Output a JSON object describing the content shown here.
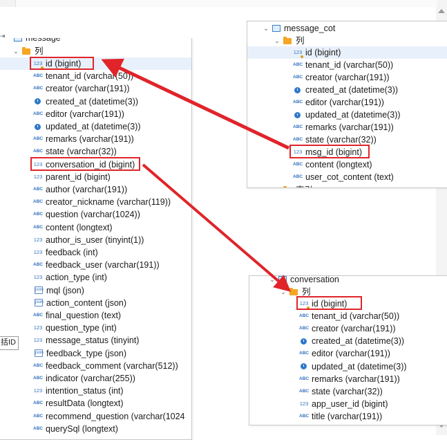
{
  "colors": {
    "highlight": "#e0242a",
    "arrow": "#e0242a",
    "selected_row": "#e8f1fb",
    "type_icon": "#3070c0",
    "folder": "#f5a623"
  },
  "side_label": "括ID",
  "message": {
    "table_name": "message",
    "columns_label": "列",
    "columns": [
      {
        "icon": "key-icon",
        "text": "id (bigint)"
      },
      {
        "icon": "abc-icon",
        "text": "tenant_id (varchar(50))"
      },
      {
        "icon": "abc-icon",
        "text": "creator (varchar(191))"
      },
      {
        "icon": "clock-icon",
        "text": "created_at (datetime(3))"
      },
      {
        "icon": "abc-icon",
        "text": "editor (varchar(191))"
      },
      {
        "icon": "clock-icon",
        "text": "updated_at (datetime(3))"
      },
      {
        "icon": "abc-icon",
        "text": "remarks (varchar(191))"
      },
      {
        "icon": "abc-icon",
        "text": "state (varchar(32))"
      },
      {
        "icon": "num-icon",
        "text": "conversation_id (bigint)"
      },
      {
        "icon": "num-icon",
        "text": "parent_id (bigint)"
      },
      {
        "icon": "abc-icon",
        "text": "author (varchar(191))"
      },
      {
        "icon": "abc-icon",
        "text": "creator_nickname (varchar(119))"
      },
      {
        "icon": "abc-icon",
        "text": "question (varchar(1024))"
      },
      {
        "icon": "abc-icon",
        "text": "content (longtext)"
      },
      {
        "icon": "num-icon",
        "text": "author_is_user (tinyint(1))"
      },
      {
        "icon": "num-icon",
        "text": "feedback (int)"
      },
      {
        "icon": "abc-icon",
        "text": "feedback_user (varchar(191))"
      },
      {
        "icon": "num-icon",
        "text": "action_type (int)"
      },
      {
        "icon": "json-icon",
        "text": "mql (json)"
      },
      {
        "icon": "json-icon",
        "text": "action_content (json)"
      },
      {
        "icon": "abc-icon",
        "text": "final_question (text)"
      },
      {
        "icon": "num-icon",
        "text": "question_type (int)"
      },
      {
        "icon": "num-icon",
        "text": "message_status (tinyint)"
      },
      {
        "icon": "json-icon",
        "text": "feedback_type (json)"
      },
      {
        "icon": "abc-icon",
        "text": "feedback_comment (varchar(512))"
      },
      {
        "icon": "abc-icon",
        "text": "indicator (varchar(255))"
      },
      {
        "icon": "num-icon",
        "text": "intention_status (int)"
      },
      {
        "icon": "abc-icon",
        "text": "resultData (longtext)"
      },
      {
        "icon": "abc-icon",
        "text": "recommend_question (varchar(1024"
      },
      {
        "icon": "abc-icon",
        "text": "querySql (longtext)"
      }
    ]
  },
  "message_cot": {
    "table_name": "message_cot",
    "columns_label": "列",
    "next_folder_label": "索引",
    "columns": [
      {
        "icon": "key-icon",
        "text": "id (bigint)"
      },
      {
        "icon": "abc-icon",
        "text": "tenant_id (varchar(50))"
      },
      {
        "icon": "abc-icon",
        "text": "creator (varchar(191))"
      },
      {
        "icon": "clock-icon",
        "text": "created_at (datetime(3))"
      },
      {
        "icon": "abc-icon",
        "text": "editor (varchar(191))"
      },
      {
        "icon": "clock-icon",
        "text": "updated_at (datetime(3))"
      },
      {
        "icon": "abc-icon",
        "text": "remarks (varchar(191))"
      },
      {
        "icon": "abc-icon",
        "text": "state (varchar(32))"
      },
      {
        "icon": "num-icon",
        "text": "msg_id (bigint)"
      },
      {
        "icon": "abc-icon",
        "text": "content (longtext)"
      },
      {
        "icon": "abc-icon",
        "text": "user_cot_content (text)"
      }
    ]
  },
  "conversation": {
    "table_name": "conversation",
    "columns_label": "列",
    "columns": [
      {
        "icon": "key-icon",
        "text": "id (bigint)"
      },
      {
        "icon": "abc-icon",
        "text": "tenant_id (varchar(50))"
      },
      {
        "icon": "abc-icon",
        "text": "creator (varchar(191))"
      },
      {
        "icon": "clock-icon",
        "text": "created_at (datetime(3))"
      },
      {
        "icon": "abc-icon",
        "text": "editor (varchar(191))"
      },
      {
        "icon": "clock-icon",
        "text": "updated_at (datetime(3))"
      },
      {
        "icon": "abc-icon",
        "text": "remarks (varchar(191))"
      },
      {
        "icon": "abc-icon",
        "text": "state (varchar(32))"
      },
      {
        "icon": "num-icon",
        "text": "app_user_id (bigint)"
      },
      {
        "icon": "abc-icon",
        "text": "title (varchar(191))"
      }
    ]
  }
}
